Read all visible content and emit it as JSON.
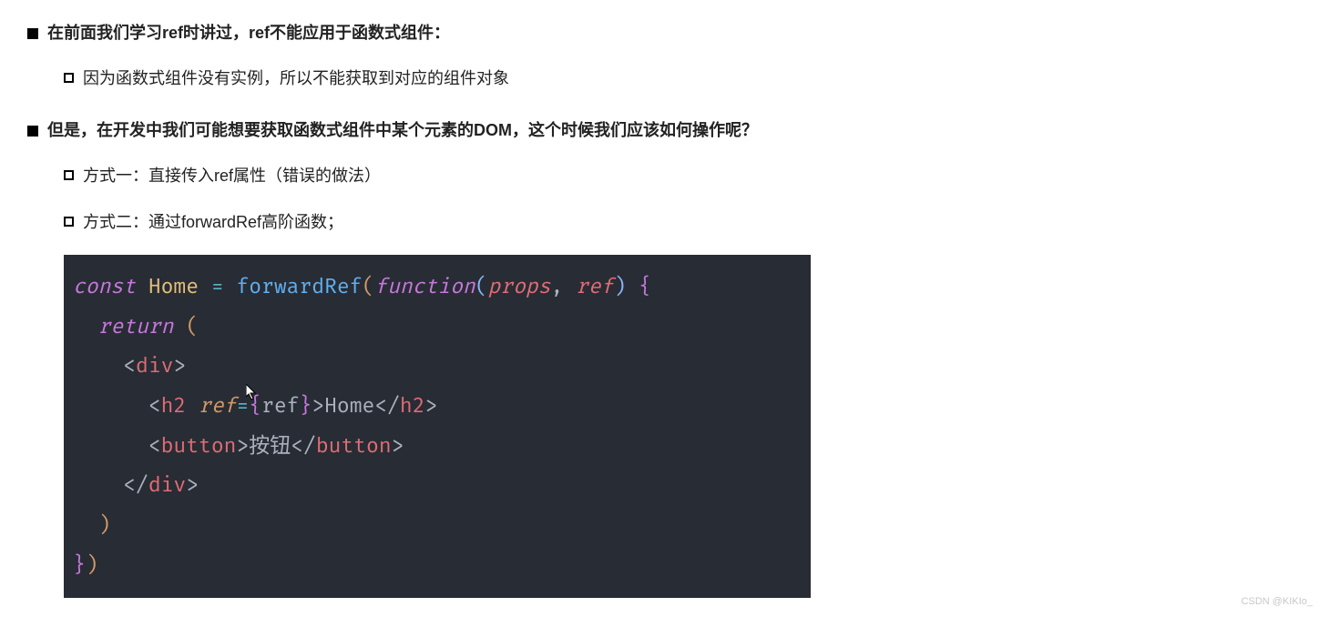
{
  "bullets": {
    "b1": "在前面我们学习ref时讲过，ref不能应用于函数式组件：",
    "b1_1": "因为函数式组件没有实例，所以不能获取到对应的组件对象",
    "b2": "但是，在开发中我们可能想要获取函数式组件中某个元素的DOM，这个时候我们应该如何操作呢？",
    "b2_1": "方式一：直接传入ref属性（错误的做法）",
    "b2_2": "方式二：通过forwardRef高阶函数；"
  },
  "code": {
    "line1": {
      "const": "const",
      "sp": " ",
      "Home": "Home",
      "eq": " = ",
      "forwardRef": "forwardRef",
      "lp": "(",
      "function": "function",
      "lp2": "(",
      "props": "props",
      "comma": ", ",
      "ref": "ref",
      "rp2": ")",
      "sp2": " ",
      "lc": "{"
    },
    "line2": {
      "return": "return",
      "sp": " ",
      "lp": "("
    },
    "line3": {
      "lt": "<",
      "tag": "div",
      "gt": ">"
    },
    "line4": {
      "lt": "<",
      "tag": "h2",
      "sp": " ",
      "attr": "ref",
      "eq": "=",
      "lb": "{",
      "ref": "ref",
      "rb": "}",
      "gt": ">",
      "txt": "Home",
      "lt2": "</",
      "tag2": "h2",
      "gt2": ">"
    },
    "line5": {
      "lt": "<",
      "tag": "button",
      "gt": ">",
      "txt": "按钮",
      "lt2": "</",
      "tag2": "button",
      "gt2": ">"
    },
    "line6": {
      "lt": "</",
      "tag": "div",
      "gt": ">"
    },
    "line7": {
      "rp": ")"
    },
    "line8": {
      "rc": "}",
      "rp": ")"
    }
  },
  "watermark": "CSDN @KIKIo_"
}
